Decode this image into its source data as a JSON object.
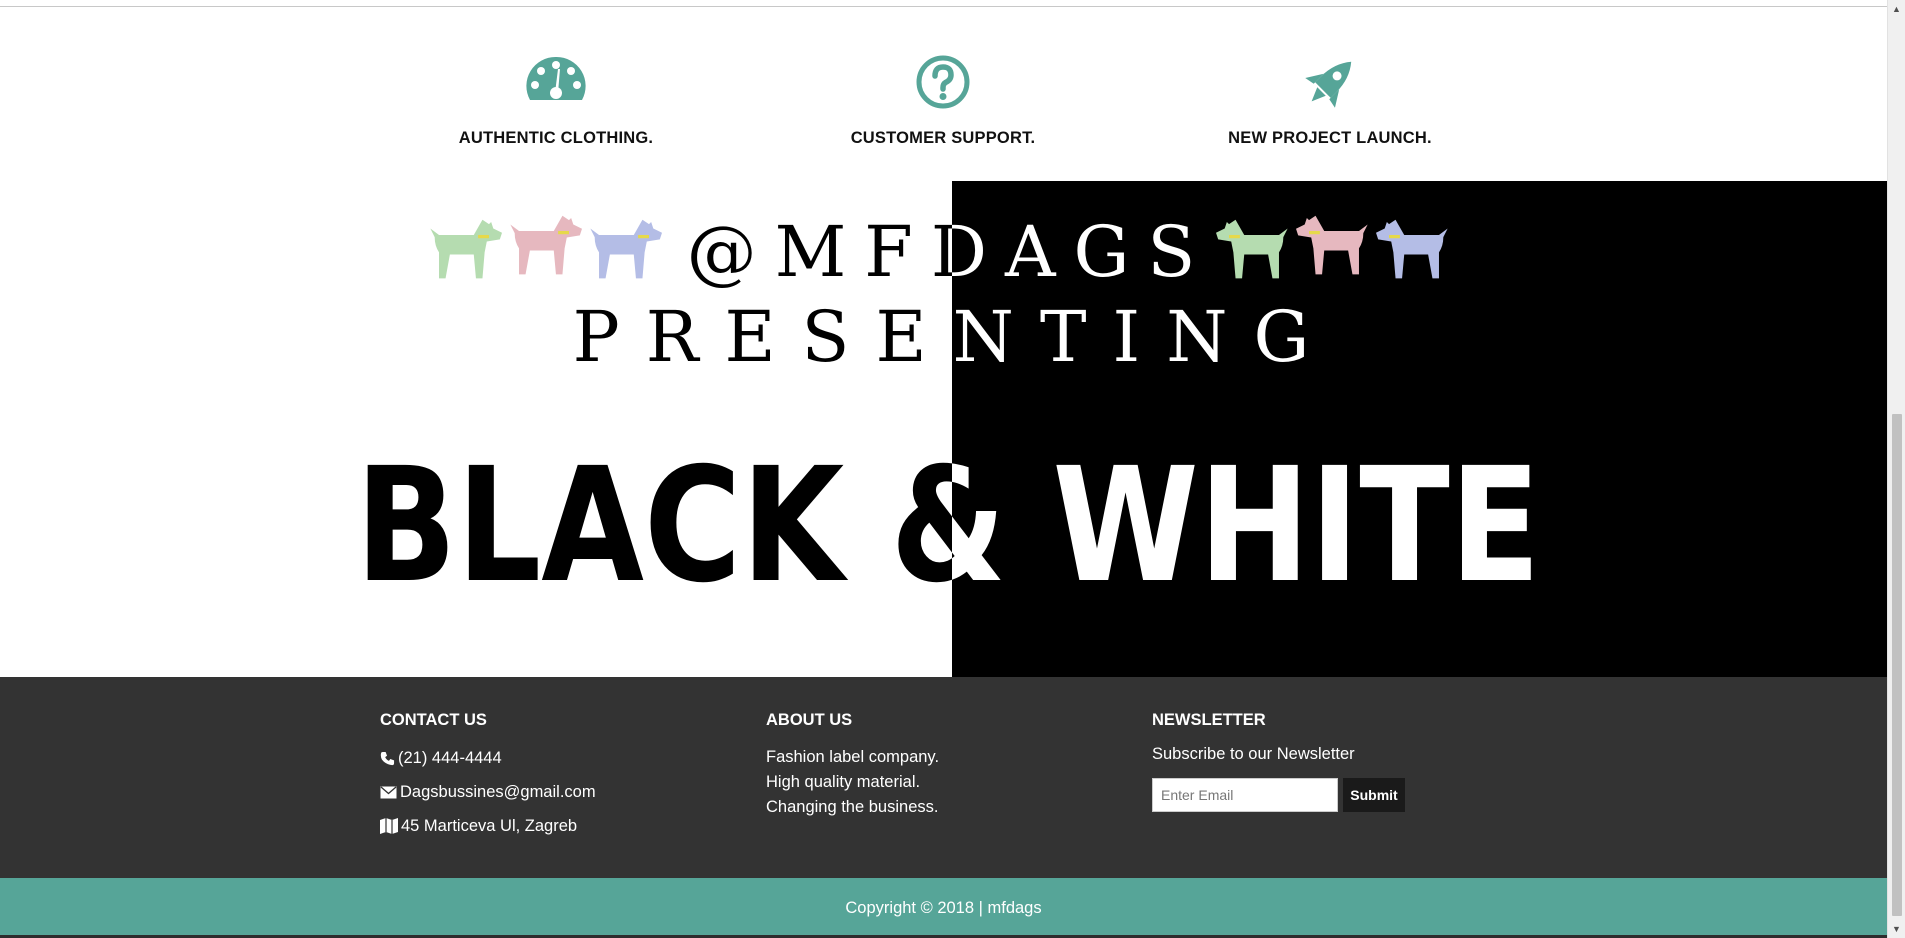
{
  "features": [
    {
      "icon": "dashboard-icon",
      "title": "AUTHENTIC CLOTHING."
    },
    {
      "icon": "question-circle-icon",
      "title": "CUSTOMER SUPPORT."
    },
    {
      "icon": "rocket-icon",
      "title": "NEW PROJECT LAUNCH."
    }
  ],
  "hero": {
    "handle": "@MFDAGS",
    "subtitle": "PRESENTING",
    "headline": "BLACK & WHITE",
    "dog_colors_left": [
      "#b5dcb0",
      "#e6b8bf",
      "#b4bde6"
    ],
    "dog_colors_right": [
      "#b4bde6",
      "#e6b8bf",
      "#b5dcb0"
    ]
  },
  "footer": {
    "contact": {
      "heading": "CONTACT US",
      "phone": "(21) 444-4444",
      "email": "Dagsbussines@gmail.com",
      "address": "45 Marticeva Ul, Zagreb"
    },
    "about": {
      "heading": "ABOUT US",
      "lines": [
        "Fashion label company.",
        "High quality material.",
        "Changing the business."
      ]
    },
    "newsletter": {
      "heading": "NEWSLETTER",
      "text": "Subscribe to our Newsletter",
      "placeholder": "Enter Email",
      "submit": "Submit"
    },
    "copyright": "Copyright © 2018 | mfdags"
  },
  "colors": {
    "accent": "#56a598",
    "footer_bg": "#333333",
    "black": "#000000"
  }
}
